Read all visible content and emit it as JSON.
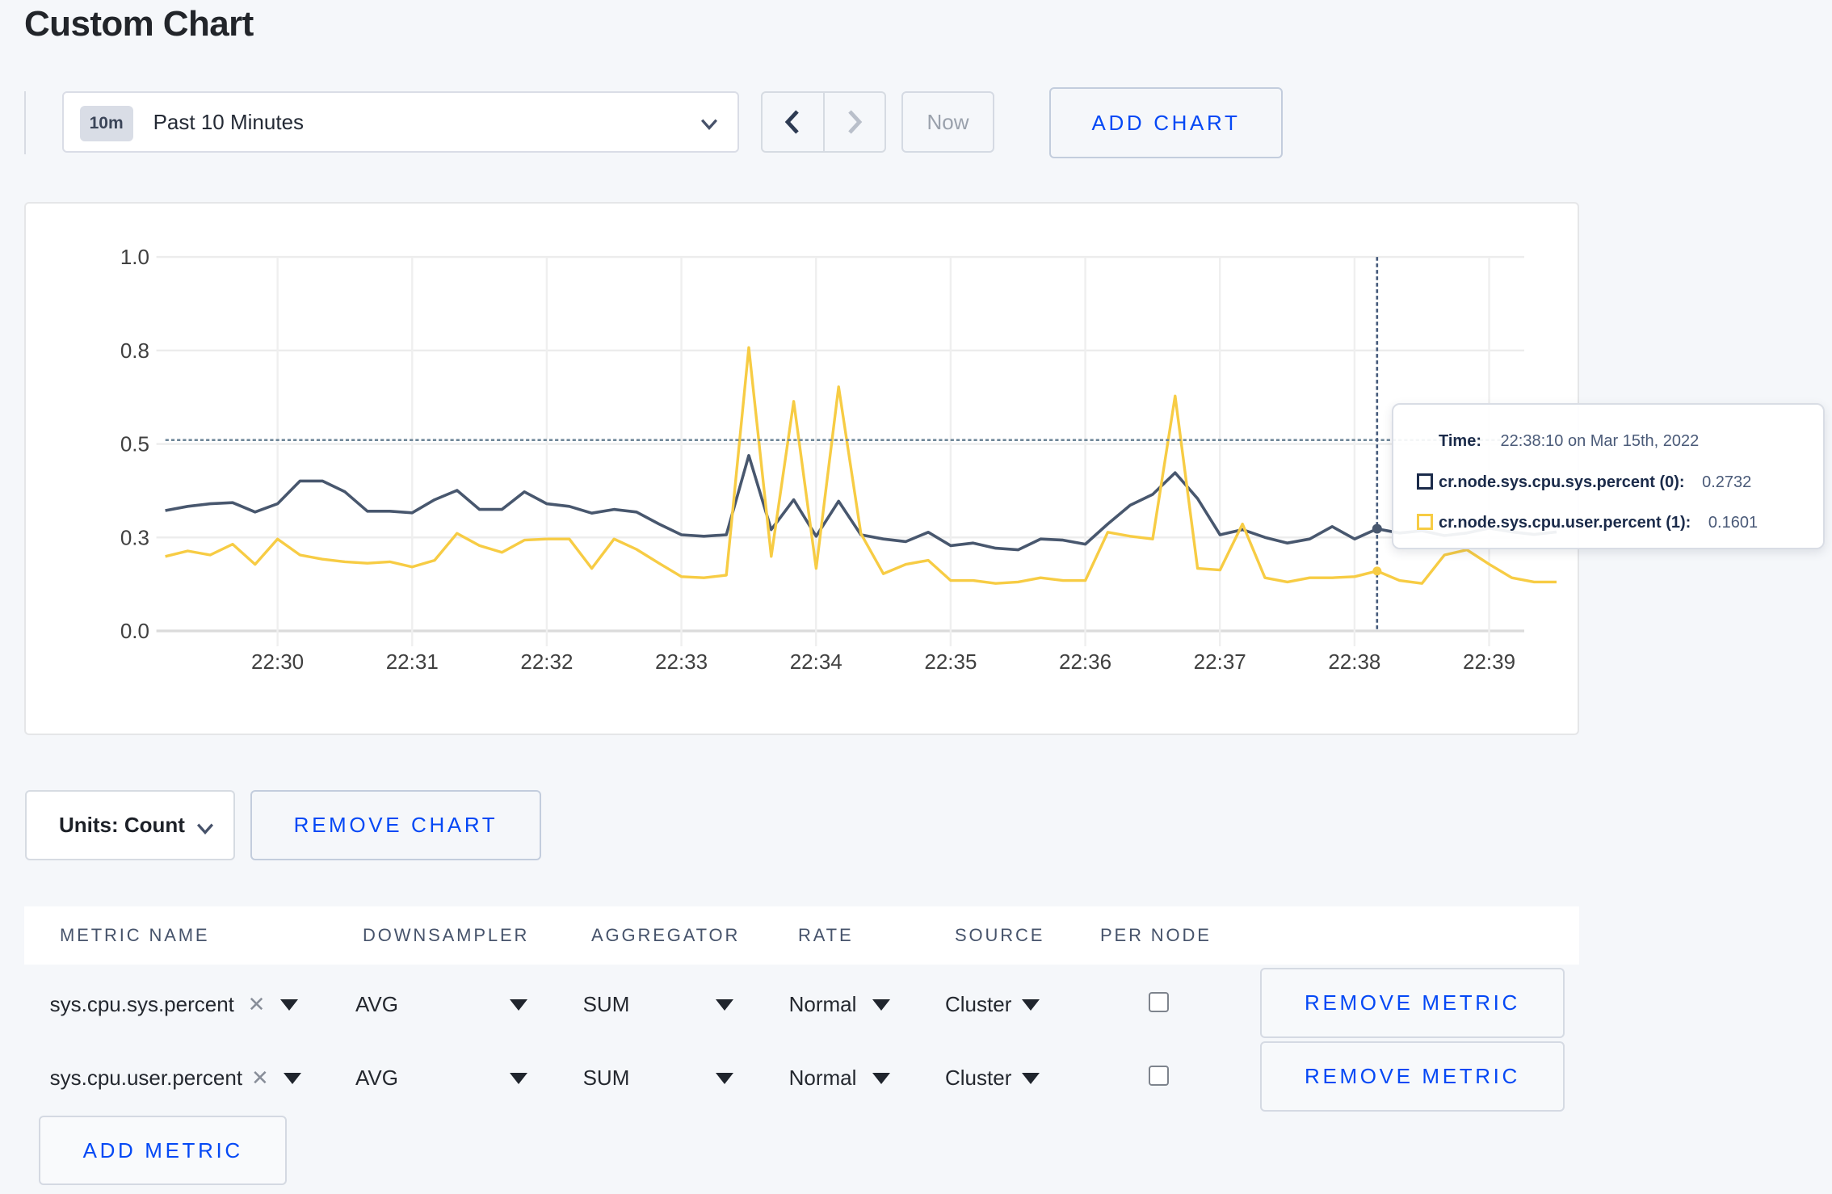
{
  "page": {
    "title": "Custom Chart"
  },
  "toolbar": {
    "time_badge": "10m",
    "time_label": "Past 10 Minutes",
    "now_label": "Now",
    "add_chart_label": "ADD CHART"
  },
  "chart_data": {
    "type": "line",
    "x_ticks": [
      "22:30",
      "22:31",
      "22:32",
      "22:33",
      "22:34",
      "22:35",
      "22:36",
      "22:37",
      "22:38",
      "22:39"
    ],
    "y_ticks": [
      {
        "label": "0.0",
        "value": 0
      },
      {
        "label": "0.3",
        "value": 0.25
      },
      {
        "label": "0.5",
        "value": 0.5
      },
      {
        "label": "0.8",
        "value": 0.75
      },
      {
        "label": "1.0",
        "value": 1.0
      }
    ],
    "ylim": [
      0,
      1
    ],
    "start_time": "22:29:10",
    "point_interval_seconds": 10,
    "series": [
      {
        "name": "cr.node.sys.cpu.sys.percent",
        "color": "#48576e",
        "values": [
          0.322,
          0.333,
          0.34,
          0.343,
          0.318,
          0.34,
          0.401,
          0.401,
          0.372,
          0.32,
          0.32,
          0.316,
          0.351,
          0.376,
          0.325,
          0.325,
          0.372,
          0.34,
          0.333,
          0.315,
          0.325,
          0.318,
          0.286,
          0.257,
          0.253,
          0.257,
          0.469,
          0.271,
          0.351,
          0.253,
          0.347,
          0.257,
          0.246,
          0.239,
          0.264,
          0.228,
          0.235,
          0.221,
          0.217,
          0.246,
          0.243,
          0.232,
          0.286,
          0.336,
          0.365,
          0.423,
          0.354,
          0.257,
          0.271,
          0.25,
          0.235,
          0.246,
          0.279,
          0.246,
          0.2732,
          0.262,
          0.268,
          0.255,
          0.262,
          0.275,
          0.265,
          0.258,
          0.265
        ]
      },
      {
        "name": "cr.node.sys.cpu.user.percent",
        "color": "#f7cc44",
        "values": [
          0.199,
          0.214,
          0.203,
          0.232,
          0.178,
          0.246,
          0.203,
          0.192,
          0.185,
          0.181,
          0.185,
          0.171,
          0.189,
          0.261,
          0.228,
          0.21,
          0.243,
          0.246,
          0.246,
          0.167,
          0.246,
          0.218,
          0.181,
          0.145,
          0.142,
          0.149,
          0.758,
          0.199,
          0.614,
          0.167,
          0.653,
          0.26,
          0.153,
          0.178,
          0.189,
          0.135,
          0.135,
          0.127,
          0.131,
          0.142,
          0.135,
          0.135,
          0.264,
          0.253,
          0.246,
          0.628,
          0.167,
          0.163,
          0.286,
          0.142,
          0.131,
          0.142,
          0.142,
          0.145,
          0.1601,
          0.135,
          0.127,
          0.203,
          0.217,
          0.178,
          0.142,
          0.131,
          0.131
        ]
      }
    ],
    "hover": {
      "time_label": "Time:",
      "time_value": "22:38:10 on Mar 15th, 2022",
      "rows": [
        {
          "label": "cr.node.sys.cpu.sys.percent (0):",
          "value": "0.2732",
          "color": "#1b2b4a"
        },
        {
          "label": "cr.node.sys.cpu.user.percent (1):",
          "value": "0.1601",
          "color": "#f7cc44"
        }
      ],
      "hline_value": 0.5105,
      "x_index": 54
    }
  },
  "chart_controls": {
    "units_label": "Units: Count",
    "remove_chart_label": "REMOVE CHART"
  },
  "metrics_table": {
    "headers": [
      "METRIC NAME",
      "DOWNSAMPLER",
      "AGGREGATOR",
      "RATE",
      "SOURCE",
      "PER NODE"
    ],
    "rows": [
      {
        "name": "sys.cpu.sys.percent",
        "remove": "✕",
        "downsampler": "AVG",
        "aggregator": "SUM",
        "rate": "Normal",
        "source": "Cluster",
        "per_node_checked": false,
        "remove_label": "REMOVE METRIC"
      },
      {
        "name": "sys.cpu.user.percent",
        "remove": "✕",
        "downsampler": "AVG",
        "aggregator": "SUM",
        "rate": "Normal",
        "source": "Cluster",
        "per_node_checked": false,
        "remove_label": "REMOVE METRIC"
      }
    ],
    "add_metric_label": "ADD METRIC"
  }
}
